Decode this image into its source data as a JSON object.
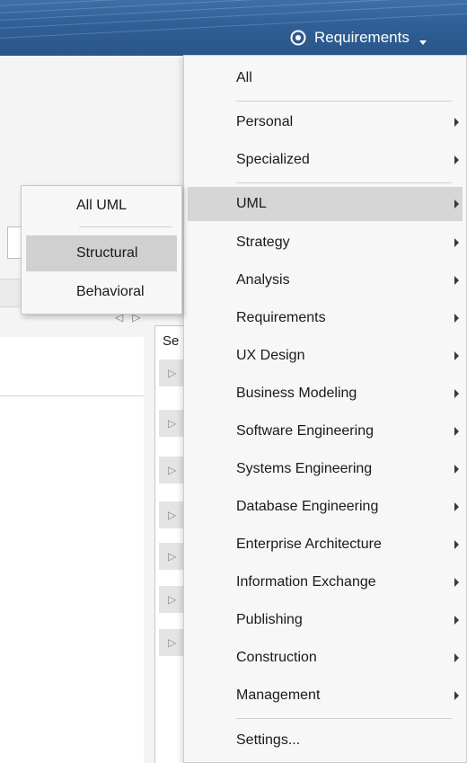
{
  "header": {
    "perspective_label": "Requirements",
    "eye_icon": "eye-icon",
    "caret_icon": "caret-down-icon"
  },
  "background": {
    "tab_label": "Se",
    "nav_prev": "◁",
    "nav_next": "▷",
    "tree_expander": "▷"
  },
  "menu": {
    "all": "All",
    "personal": "Personal",
    "specialized": "Specialized",
    "uml": "UML",
    "strategy": "Strategy",
    "analysis": "Analysis",
    "requirements": "Requirements",
    "ux_design": "UX Design",
    "business_modeling": "Business Modeling",
    "software_engineering": "Software Engineering",
    "systems_engineering": "Systems Engineering",
    "database_engineering": "Database Engineering",
    "enterprise_architecture": "Enterprise Architecture",
    "information_exchange": "Information Exchange",
    "publishing": "Publishing",
    "construction": "Construction",
    "management": "Management",
    "settings": "Settings..."
  },
  "submenu": {
    "all_uml": "All UML",
    "structural": "Structural",
    "behavioral": "Behavioral"
  },
  "colors": {
    "ribbon": "#2f5f96",
    "menu_background": "#f7f7f7",
    "highlight": "#d6d6d6"
  }
}
